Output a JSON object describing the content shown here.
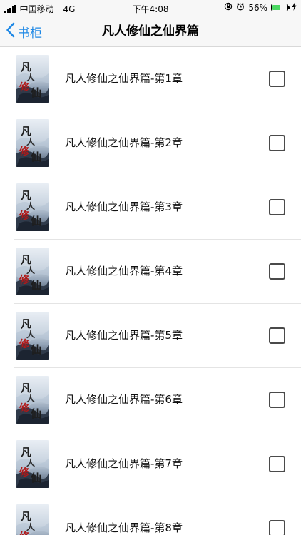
{
  "status_bar": {
    "carrier": "中国移动",
    "network": "4G",
    "time": "下午4:08",
    "battery_percent": "56%",
    "battery_level": 0.56,
    "battery_color": "#4cd964"
  },
  "nav": {
    "back_label": "书柜",
    "title": "凡人修仙之仙界篇",
    "accent_color": "#1e88e5"
  },
  "chapters": [
    {
      "title": "凡人修仙之仙界篇-第1章",
      "checked": false
    },
    {
      "title": "凡人修仙之仙界篇-第2章",
      "checked": false
    },
    {
      "title": "凡人修仙之仙界篇-第3章",
      "checked": false
    },
    {
      "title": "凡人修仙之仙界篇-第4章",
      "checked": false
    },
    {
      "title": "凡人修仙之仙界篇-第5章",
      "checked": false
    },
    {
      "title": "凡人修仙之仙界篇-第6章",
      "checked": false
    },
    {
      "title": "凡人修仙之仙界篇-第7章",
      "checked": false
    },
    {
      "title": "凡人修仙之仙界篇-第8章",
      "checked": false
    }
  ]
}
